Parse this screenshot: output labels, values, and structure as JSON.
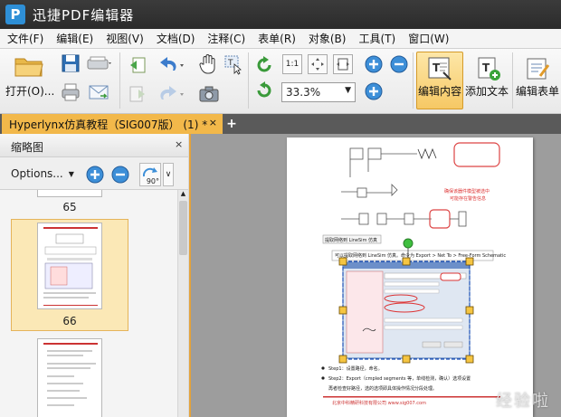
{
  "app": {
    "title": "迅捷PDF编辑器",
    "logo_letter": "P"
  },
  "menu": [
    "文件(F)",
    "编辑(E)",
    "视图(V)",
    "文档(D)",
    "注释(C)",
    "表单(R)",
    "对象(B)",
    "工具(T)",
    "窗口(W)"
  ],
  "toolbar": {
    "open_label": "打开(O)...",
    "zoom_value": "33.3%",
    "edit_content_label": "编辑内容",
    "add_text_label": "添加文本",
    "edit_form_label": "编辑表单"
  },
  "tab": {
    "title": "Hyperlynx仿真教程（SIG007版） (1) *",
    "close": "×",
    "new": "+"
  },
  "thumbnails": {
    "title": "缩略图",
    "close": "×",
    "options_label": "Options...",
    "rotate_label": "90°",
    "pages": [
      "65",
      "66"
    ]
  },
  "page": {
    "red_note_1": "确保该器件模型被选中",
    "red_note_2": "可能存在警告信息",
    "caption": "提取网络到 LineSim 仿真",
    "instruction": "可以提取网络到 LineSim 仿真。命令为 Export > Net To > Free-Form Schematic",
    "bullet_1": "Step1：设置路径，命名。",
    "bullet_2": "Step2：Export（cmpled segments 等，单线检测，确认）选项设置",
    "line_3": "再者检查好路径，选的选项即具体操作情况分段处理。",
    "footer": "北京中科精研科技有限公司  www.sig007.com"
  },
  "watermark": "经验啦",
  "colors": {
    "accent": "#f2b84a",
    "titlebar": "#2b2b2b"
  }
}
